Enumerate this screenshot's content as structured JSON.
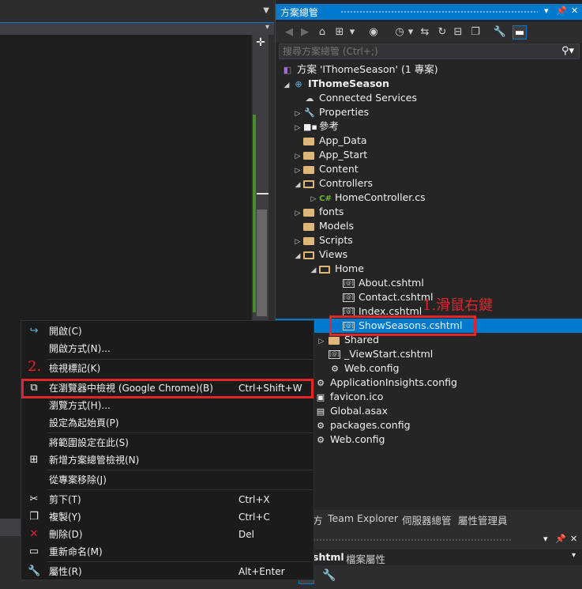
{
  "solution_explorer": {
    "title": "方案總管",
    "search_placeholder": "搜尋方案總管 (Ctrl+;)",
    "tree": [
      {
        "label": "方案 'IThomeSeason' (1 專案)"
      },
      {
        "label": "IThomeSeason"
      },
      {
        "label": "Connected Services"
      },
      {
        "label": "Properties"
      },
      {
        "label": "參考"
      },
      {
        "label": "App_Data"
      },
      {
        "label": "App_Start"
      },
      {
        "label": "Content"
      },
      {
        "label": "Controllers"
      },
      {
        "label": "HomeController.cs"
      },
      {
        "label": "fonts"
      },
      {
        "label": "Models"
      },
      {
        "label": "Scripts"
      },
      {
        "label": "Views"
      },
      {
        "label": "Home"
      },
      {
        "label": "About.cshtml"
      },
      {
        "label": "Contact.cshtml"
      },
      {
        "label": "Index.cshtml"
      },
      {
        "label": "ShowSeasons.cshtml"
      },
      {
        "label": "Shared"
      },
      {
        "label": "_ViewStart.cshtml"
      },
      {
        "label": "Web.config"
      },
      {
        "label": "ApplicationInsights.config"
      },
      {
        "label": "favicon.ico"
      },
      {
        "label": "Global.asax"
      },
      {
        "label": "packages.config"
      },
      {
        "label": "Web.config"
      }
    ],
    "bottom_tabs": [
      "Team Explorer",
      "伺服器總管",
      "屬性管理員"
    ],
    "tab_prefix": "方"
  },
  "properties": {
    "subtitle_file": "shtml",
    "subtitle_label": "檔案屬性"
  },
  "annotations": {
    "step1": "1.滑鼠右鍵",
    "step2": "2."
  },
  "context_menu": {
    "items": [
      {
        "label": "開啟(C)",
        "shortcut": "",
        "icon": "open-icon"
      },
      {
        "label": "開啟方式(N)...",
        "shortcut": "",
        "icon": ""
      },
      {
        "label": "檢視標記(K)",
        "shortcut": "",
        "icon": ""
      },
      {
        "label": "在瀏覽器中檢視 (Google Chrome)(B)",
        "shortcut": "Ctrl+Shift+W",
        "icon": "browser-icon"
      },
      {
        "label": "瀏覽方式(H)...",
        "shortcut": "",
        "icon": ""
      },
      {
        "label": "設定為起始頁(P)",
        "shortcut": "",
        "icon": ""
      },
      {
        "label": "將範圍設定在此(S)",
        "shortcut": "",
        "icon": ""
      },
      {
        "label": "新增方案總管檢視(N)",
        "shortcut": "",
        "icon": "new-view-icon"
      },
      {
        "label": "從專案移除(J)",
        "shortcut": "",
        "icon": ""
      },
      {
        "label": "剪下(T)",
        "shortcut": "Ctrl+X",
        "icon": "cut-icon"
      },
      {
        "label": "複製(Y)",
        "shortcut": "Ctrl+C",
        "icon": "copy-icon"
      },
      {
        "label": "刪除(D)",
        "shortcut": "Del",
        "icon": "delete-icon"
      },
      {
        "label": "重新命名(M)",
        "shortcut": "",
        "icon": "rename-icon"
      },
      {
        "label": "屬性(R)",
        "shortcut": "Alt+Enter",
        "icon": "wrench-icon"
      }
    ]
  },
  "colors": {
    "accent": "#007acc",
    "annotation_red": "#e2242b",
    "folder": "#dcb67a"
  }
}
